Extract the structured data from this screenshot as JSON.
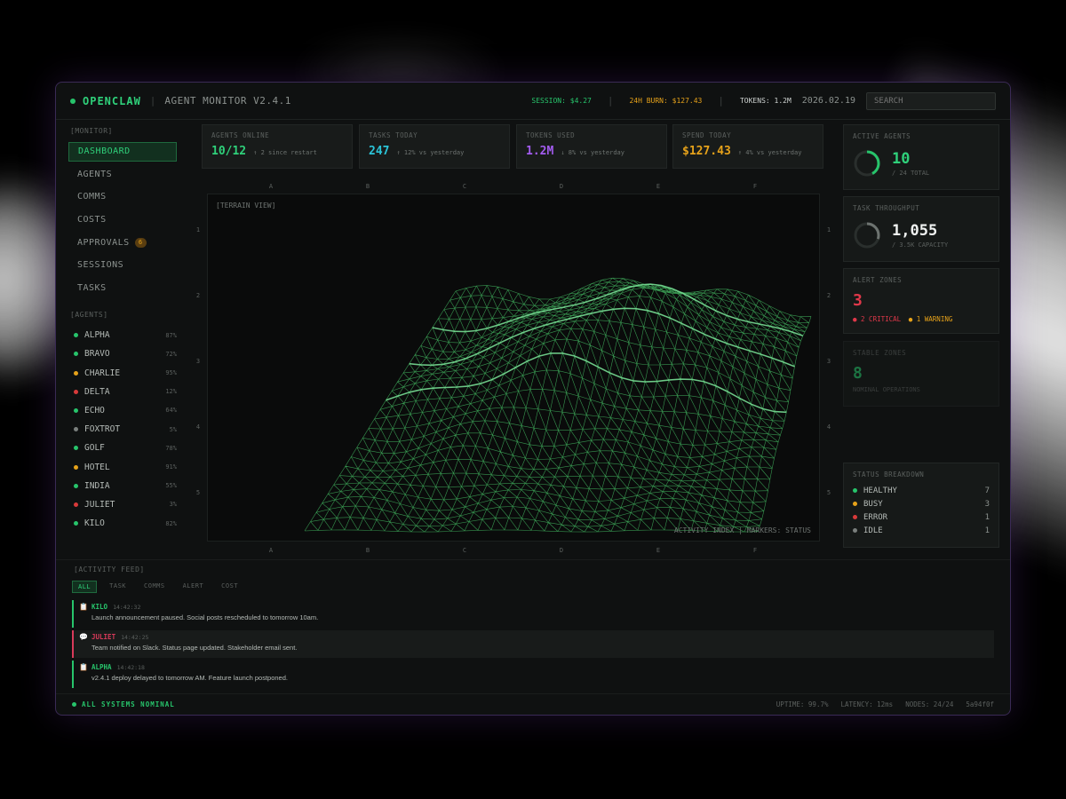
{
  "header": {
    "brand": "OPENCLAW",
    "separator": "|",
    "subtitle": "AGENT MONITOR V2.4.1",
    "session": "SESSION: $4.27",
    "burn": "24H BURN: $127.43",
    "tokens": "TOKENS: 1.2M",
    "date": "2026.02.19",
    "search_placeholder": "SEARCH"
  },
  "sidebar": {
    "monitor_label": "[MONITOR]",
    "nav": [
      {
        "label": "DASHBOARD",
        "active": true
      },
      {
        "label": "AGENTS"
      },
      {
        "label": "COMMS"
      },
      {
        "label": "COSTS"
      },
      {
        "label": "APPROVALS",
        "badge": "6"
      },
      {
        "label": "SESSIONS"
      },
      {
        "label": "TASKS"
      }
    ],
    "agents_label": "[AGENTS]",
    "agents": [
      {
        "name": "ALPHA",
        "pct": "87%",
        "color": "#27c46b"
      },
      {
        "name": "BRAVO",
        "pct": "72%",
        "color": "#27c46b"
      },
      {
        "name": "CHARLIE",
        "pct": "95%",
        "color": "#e6a21a"
      },
      {
        "name": "DELTA",
        "pct": "12%",
        "color": "#d83a3a"
      },
      {
        "name": "ECHO",
        "pct": "64%",
        "color": "#27c46b"
      },
      {
        "name": "FOXTROT",
        "pct": "5%",
        "color": "#7a7f7d"
      },
      {
        "name": "GOLF",
        "pct": "78%",
        "color": "#27c46b"
      },
      {
        "name": "HOTEL",
        "pct": "91%",
        "color": "#e6a21a"
      },
      {
        "name": "INDIA",
        "pct": "55%",
        "color": "#27c46b"
      },
      {
        "name": "JULIET",
        "pct": "3%",
        "color": "#d83a3a"
      },
      {
        "name": "KILO",
        "pct": "82%",
        "color": "#27c46b"
      }
    ]
  },
  "stats": [
    {
      "label": "AGENTS ONLINE",
      "value": "10/12",
      "note": "↑ 2 since restart",
      "color": "#2fd07a"
    },
    {
      "label": "TASKS TODAY",
      "value": "247",
      "note": "↑ 12% vs yesterday",
      "color": "#2bc4d8"
    },
    {
      "label": "TOKENS USED",
      "value": "1.2M",
      "note": "↓ 8% vs yesterday",
      "color": "#a35cf0"
    },
    {
      "label": "SPEND TODAY",
      "value": "$127.43",
      "note": "↑ 4% vs yesterday",
      "color": "#e6a21a"
    }
  ],
  "terrain": {
    "title": "[TERRAIN VIEW]",
    "caption": "ACTIVITY INDEX | MARKERS: STATUS",
    "col_labels": [
      "A",
      "B",
      "C",
      "D",
      "E",
      "F"
    ],
    "row_labels": [
      "1",
      "2",
      "3",
      "4",
      "5"
    ]
  },
  "right": {
    "active_agents": {
      "label": "ACTIVE AGENTS",
      "value": "10",
      "sub": "/ 24 TOTAL",
      "fraction": 0.42
    },
    "throughput": {
      "label": "TASK THROUGHPUT",
      "value": "1,055",
      "sub": "/ 3.5K CAPACITY",
      "fraction": 0.3
    },
    "alerts": {
      "label": "ALERT ZONES",
      "value": "3",
      "critical": "● 2 CRITICAL",
      "warning": "● 1 WARNING"
    },
    "stable": {
      "label": "STABLE ZONES",
      "value": "8",
      "sub": "NOMINAL OPERATIONS"
    },
    "breakdown": {
      "label": "STATUS BREAKDOWN",
      "rows": [
        {
          "name": "HEALTHY",
          "count": "7",
          "color": "#27c46b"
        },
        {
          "name": "BUSY",
          "count": "3",
          "color": "#e6a21a"
        },
        {
          "name": "ERROR",
          "count": "1",
          "color": "#d83a3a"
        },
        {
          "name": "IDLE",
          "count": "1",
          "color": "#7a7f7d"
        }
      ]
    }
  },
  "feed": {
    "label": "[ACTIVITY FEED]",
    "filters": [
      "ALL",
      "TASK",
      "COMMS",
      "ALERT",
      "COST"
    ],
    "items": [
      {
        "agent": "KILO",
        "time": "14:42:32",
        "msg": "Launch announcement paused. Social posts rescheduled to tomorrow 10am.",
        "color": "#27c46b",
        "icon": "📋"
      },
      {
        "agent": "JULIET",
        "time": "14:42:25",
        "msg": "Team notified on Slack. Status page updated. Stakeholder email sent.",
        "color": "#d83a5a",
        "icon": "💬"
      },
      {
        "agent": "ALPHA",
        "time": "14:42:18",
        "msg": "v2.4.1 deploy delayed to tomorrow AM. Feature launch postponed.",
        "color": "#27c46b",
        "icon": "📋"
      }
    ]
  },
  "footer": {
    "status": "ALL SYSTEMS NOMINAL",
    "uptime": "UPTIME: 99.7%",
    "latency": "LATENCY: 12ms",
    "nodes": "NODES: 24/24",
    "hash": "5a94f0f"
  }
}
